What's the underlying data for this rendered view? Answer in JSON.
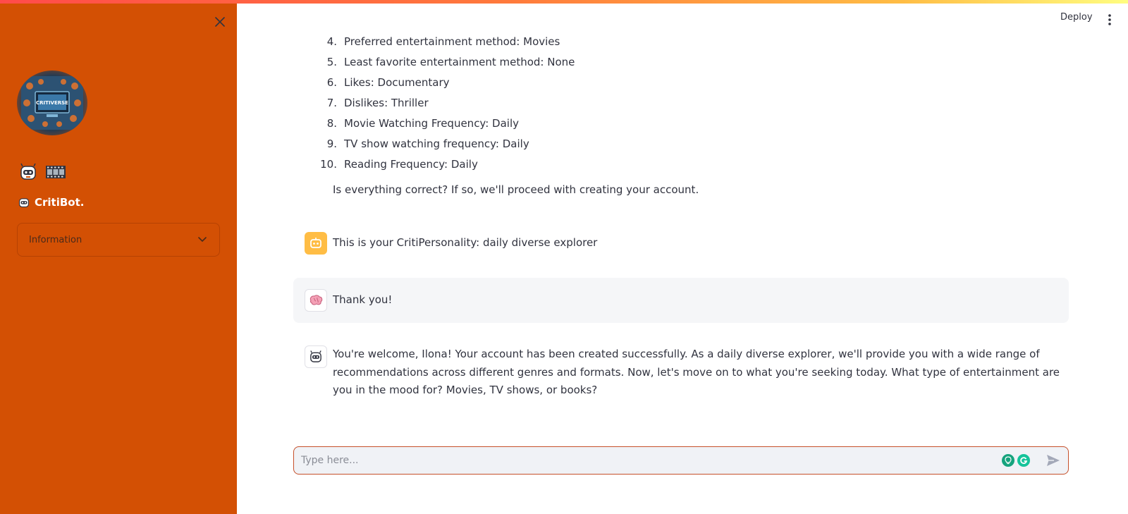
{
  "header": {
    "deploy_label": "Deploy"
  },
  "sidebar": {
    "logo_text": "CRITIVERSE",
    "bot_name": "CritiBot.",
    "expander_label": "Information"
  },
  "profile_list": [
    {
      "num": "4.",
      "text": "Preferred entertainment method: Movies"
    },
    {
      "num": "5.",
      "text": "Least favorite entertainment method: None"
    },
    {
      "num": "6.",
      "text": "Likes: Documentary"
    },
    {
      "num": "7.",
      "text": "Dislikes: Thriller"
    },
    {
      "num": "8.",
      "text": "Movie Watching Frequency: Daily"
    },
    {
      "num": "9.",
      "text": "TV show watching frequency: Daily"
    },
    {
      "num": "10.",
      "text": "Reading Frequency: Daily"
    }
  ],
  "confirm_question": "Is everything correct? If so, we'll proceed with creating your account.",
  "messages": [
    {
      "role": "assistant",
      "text": "This is your CritiPersonality: daily diverse explorer"
    },
    {
      "role": "user",
      "text": "Thank you!"
    },
    {
      "role": "bot",
      "text": "You're welcome, Ilona! Your account has been created successfully. As a daily diverse explorer, we'll provide you with a wide range of recommendations across different genres and formats. Now, let's move on to what you're seeking today. What type of entertainment are you in the mood for? Movies, TV shows, or books?"
    }
  ],
  "chat_input": {
    "placeholder": "Type here..."
  },
  "colors": {
    "sidebar": "#d35004",
    "assistant_avatar": "#ffbd45",
    "input_border": "#c6502a"
  }
}
